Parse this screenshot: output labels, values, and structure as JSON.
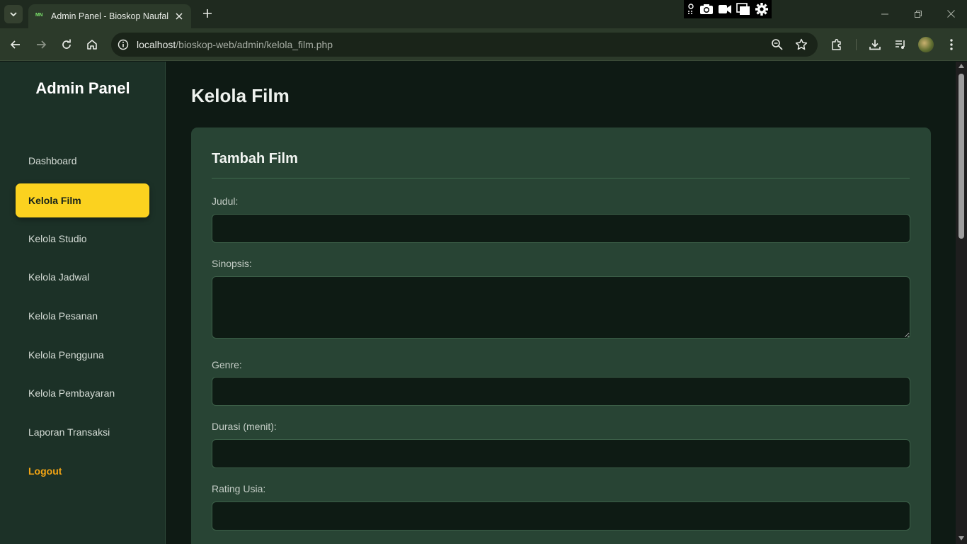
{
  "browser": {
    "tab_title": "Admin Panel - Bioskop Naufal",
    "favicon_text": "MN",
    "url_host": "localhost",
    "url_path": "/bioskop-web/admin/kelola_film.php"
  },
  "sidebar": {
    "brand": "Admin Panel",
    "items": [
      {
        "label": "Dashboard"
      },
      {
        "label": "Kelola Film"
      },
      {
        "label": "Kelola Studio"
      },
      {
        "label": "Kelola Jadwal"
      },
      {
        "label": "Kelola Pesanan"
      },
      {
        "label": "Kelola Pengguna"
      },
      {
        "label": "Kelola Pembayaran"
      },
      {
        "label": "Laporan Transaksi"
      }
    ],
    "logout": "Logout",
    "active_index": 1
  },
  "main": {
    "title": "Kelola Film",
    "form": {
      "title": "Tambah Film",
      "fields": [
        {
          "label": "Judul:",
          "value": ""
        },
        {
          "label": "Sinopsis:",
          "value": ""
        },
        {
          "label": "Genre:",
          "value": ""
        },
        {
          "label": "Durasi (menit):",
          "value": ""
        },
        {
          "label": "Rating Usia:",
          "value": ""
        }
      ]
    }
  },
  "colors": {
    "accent": "#fbd21f",
    "logout": "#f3a514",
    "sidebar_bg": "#1c3127",
    "card_bg": "#284434",
    "page_bg": "#0e1a14"
  }
}
